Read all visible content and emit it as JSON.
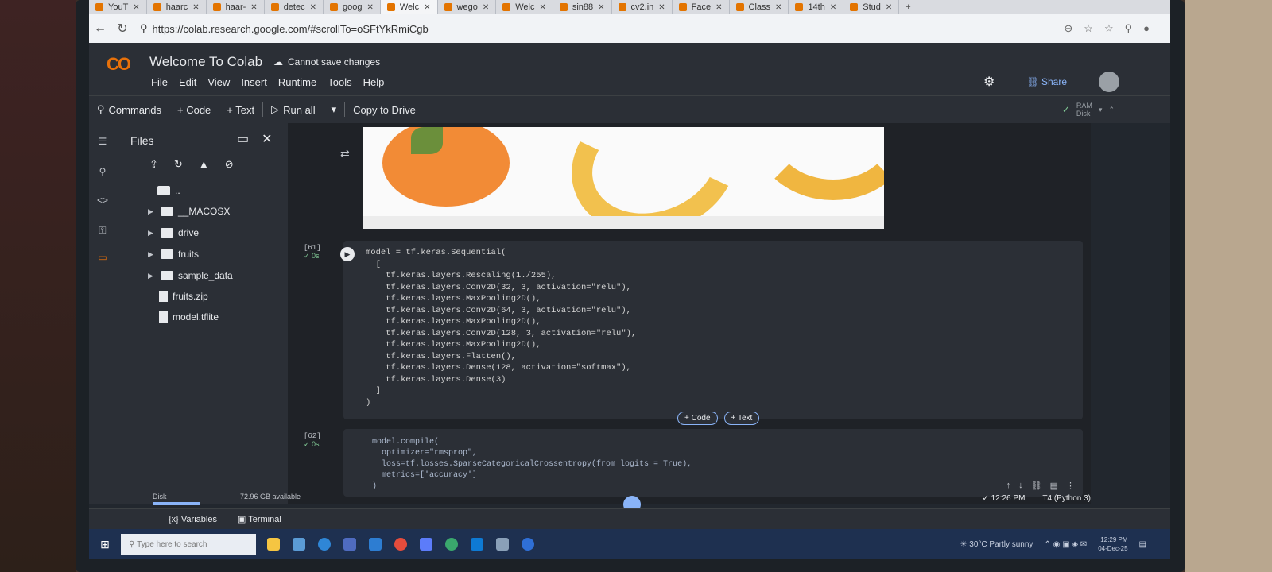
{
  "browser": {
    "tabs": [
      {
        "label": "YouT"
      },
      {
        "label": "haarc"
      },
      {
        "label": "haar-"
      },
      {
        "label": "detec"
      },
      {
        "label": "goog"
      },
      {
        "label": "Welc",
        "active": true
      },
      {
        "label": "wego"
      },
      {
        "label": "Welc"
      },
      {
        "label": "sin88"
      },
      {
        "label": "cv2.in"
      },
      {
        "label": "Face"
      },
      {
        "label": "Class"
      },
      {
        "label": "14th"
      },
      {
        "label": "Stud"
      }
    ],
    "close_glyph": "✕",
    "new_tab": "+",
    "url": "https://colab.research.google.com/#scrollTo=oSFtYkRmiCgb"
  },
  "colab": {
    "logo": "CO",
    "title": "Welcome To Colab",
    "save_status": "Cannot save changes",
    "menu": [
      "File",
      "Edit",
      "View",
      "Insert",
      "Runtime",
      "Tools",
      "Help"
    ],
    "share": "Share",
    "toolbar": {
      "commands": "Commands",
      "code": "+ Code",
      "text": "+ Text",
      "run_all": "Run all",
      "copy_to_drive": "Copy to Drive",
      "ram": "RAM",
      "disk": "Disk"
    }
  },
  "files": {
    "title": "Files",
    "tree": [
      {
        "name": "..",
        "type": "folder"
      },
      {
        "name": "__MACOSX",
        "type": "folder"
      },
      {
        "name": "drive",
        "type": "folder"
      },
      {
        "name": "fruits",
        "type": "folder"
      },
      {
        "name": "sample_data",
        "type": "folder"
      },
      {
        "name": "fruits.zip",
        "type": "file"
      },
      {
        "name": "model.tflite",
        "type": "file"
      }
    ],
    "disk_label": "Disk",
    "disk_free": "72.96 GB available"
  },
  "cells": {
    "cell61": {
      "count": "[61]",
      "time": "✓ 0s",
      "code": "model = tf.keras.Sequential(\n  [\n    tf.keras.layers.Rescaling(1./255),\n    tf.keras.layers.Conv2D(32, 3, activation=\"relu\"),\n    tf.keras.layers.MaxPooling2D(),\n    tf.keras.layers.Conv2D(64, 3, activation=\"relu\"),\n    tf.keras.layers.MaxPooling2D(),\n    tf.keras.layers.Conv2D(128, 3, activation=\"relu\"),\n    tf.keras.layers.MaxPooling2D(),\n    tf.keras.layers.Flatten(),\n    tf.keras.layers.Dense(128, activation=\"softmax\"),\n    tf.keras.layers.Dense(3)\n  ]\n)"
    },
    "cell62": {
      "count": "[62]",
      "time": "✓ 0s",
      "code": "model.compile(\n  optimizer=\"rmsprop\",\n  loss=tf.losses.SparseCategoricalCrossentropy(from_logits = True),\n  metrics=['accuracy']\n)"
    },
    "add_code": "+ Code",
    "add_text": "+ Text"
  },
  "status": {
    "exec_time": "✓ 12:26 PM",
    "runtime": "T4 (Python 3)",
    "variables": "Variables",
    "terminal": "Terminal"
  },
  "taskbar": {
    "search_placeholder": "Type here to search",
    "weather": "30°C Partly sunny",
    "time": "12:29 PM",
    "date": "04-Dec-25"
  }
}
